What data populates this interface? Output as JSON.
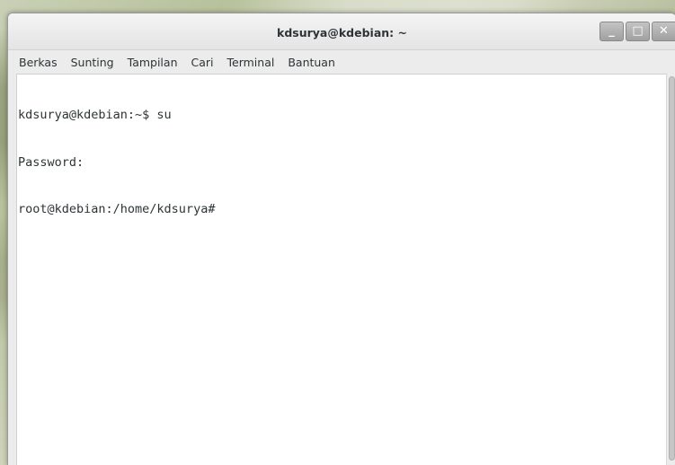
{
  "window": {
    "title": "kdsurya@kdebian: ~",
    "buttons": {
      "minimize_glyph": "_",
      "maximize_glyph": "□",
      "close_glyph": "✕"
    }
  },
  "menubar": {
    "items": [
      {
        "label": "Berkas"
      },
      {
        "label": "Sunting"
      },
      {
        "label": "Tampilan"
      },
      {
        "label": "Cari"
      },
      {
        "label": "Terminal"
      },
      {
        "label": "Bantuan"
      }
    ]
  },
  "terminal": {
    "lines": [
      "kdsurya@kdebian:~$ su",
      "Password:",
      "root@kdebian:/home/kdsurya#"
    ]
  },
  "icons": {
    "minimize": "minimize-icon",
    "maximize": "maximize-icon",
    "close": "close-icon"
  },
  "colors": {
    "terminal_background": "#ffffff",
    "terminal_text": "#2e3436",
    "titlebar": "#ececec"
  }
}
